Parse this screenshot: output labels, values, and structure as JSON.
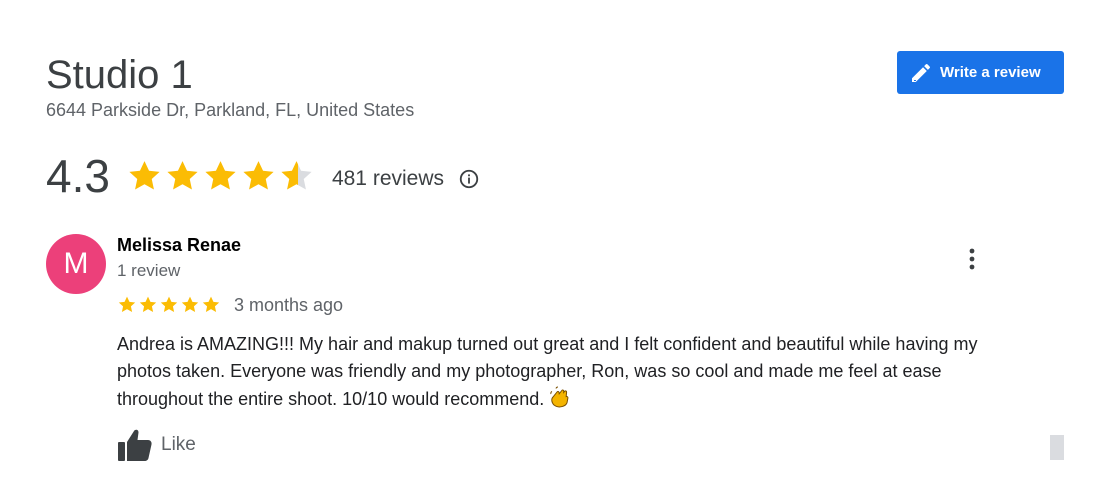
{
  "business": {
    "name": "Studio 1",
    "address": "6644 Parkside Dr, Parkland, FL, United States"
  },
  "actions": {
    "write_review_label": "Write a review",
    "write_review_icon": "pencil-icon"
  },
  "summary": {
    "rating": "4.3",
    "rating_value": 4.3,
    "max_rating": 5,
    "review_count": "481 reviews",
    "info_icon": "info-icon"
  },
  "review": {
    "avatar_letter": "M",
    "author": "Melissa Renae",
    "author_review_count": "1 review",
    "stars": 5,
    "time_ago": "3 months ago",
    "text": "Andrea is AMAZING!!!  My hair and makup turned out great and I felt confident and beautiful while having my photos taken. Everyone was friendly and my photographer, Ron, was so cool and made me feel at ease throughout the entire shoot. 10/10 would recommend.",
    "emoji": "clapping-hands",
    "like_label": "Like",
    "menu_icon": "more-vert-icon"
  },
  "colors": {
    "star": "#fbbc04",
    "star_empty": "#dadce0",
    "button": "#1a73e8",
    "avatar": "#ec407a"
  }
}
